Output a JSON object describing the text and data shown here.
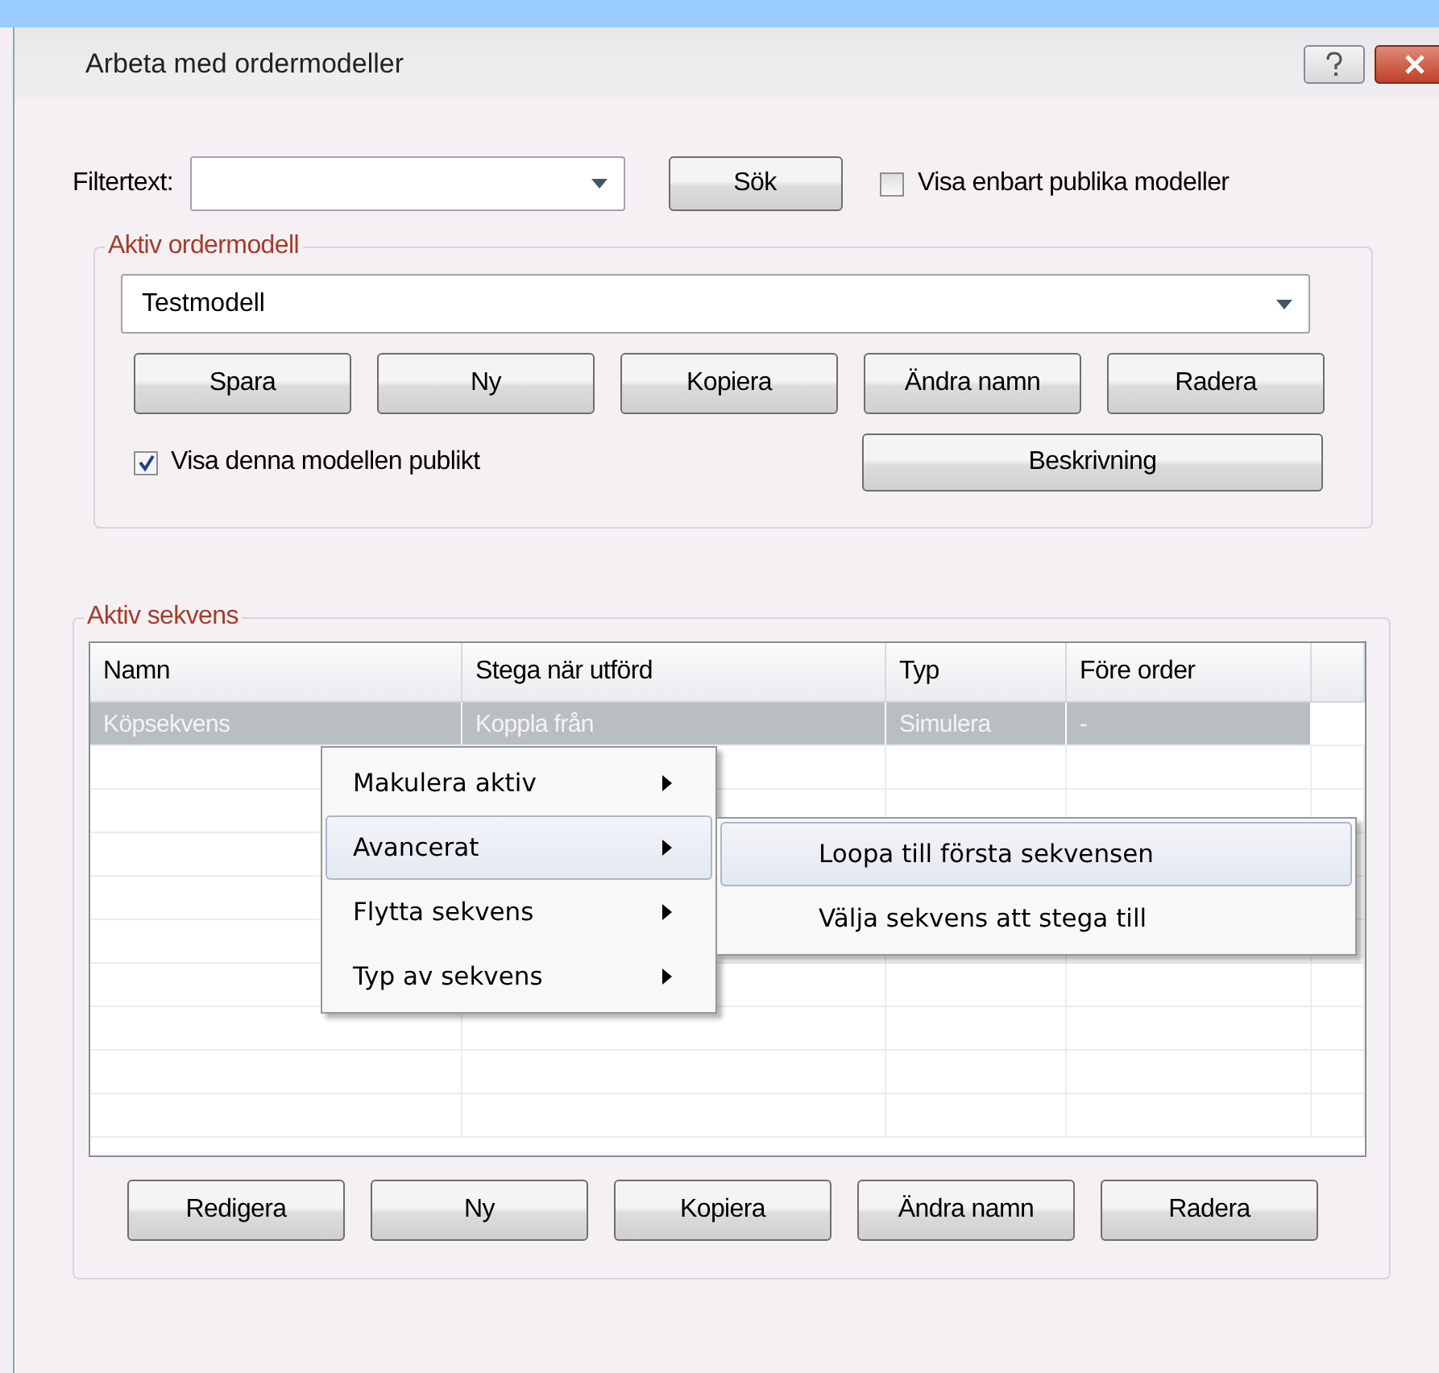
{
  "window": {
    "title": "Arbeta med ordermodeller"
  },
  "filter": {
    "label": "Filtertext:",
    "search_button": "Sök",
    "public_only": {
      "label": "Visa enbart publika modeller",
      "checked": false
    }
  },
  "model_group": {
    "legend": "Aktiv ordermodell",
    "model": "Testmodell",
    "buttons": [
      "Spara",
      "Ny",
      "Kopiera",
      "Ändra namn",
      "Radera"
    ],
    "publish": {
      "label": "Visa denna modellen publikt",
      "checked": true
    },
    "description_button": "Beskrivning"
  },
  "sequence_group": {
    "legend": "Aktiv sekvens",
    "table": {
      "columns": [
        "Namn",
        "Stega när utförd",
        "Typ",
        "Före order"
      ],
      "rows": [
        {
          "cells": [
            "Köpsekvens",
            "Koppla från",
            "Simulera",
            "-"
          ],
          "selected": true
        }
      ]
    },
    "buttons": [
      "Redigera",
      "Ny",
      "Kopiera",
      "Ändra namn",
      "Radera"
    ]
  },
  "context_menu": {
    "items": [
      {
        "label": "Makulera aktiv",
        "selected": false
      },
      {
        "label": "Avancerat",
        "selected": true
      },
      {
        "label": "Flytta sekvens",
        "selected": false
      },
      {
        "label": "Typ av sekvens",
        "selected": false
      }
    ],
    "submenu": [
      {
        "label": "Loopa till första sekvensen",
        "selected": true
      },
      {
        "label": "Välja sekvens att stega till",
        "selected": false
      }
    ]
  }
}
